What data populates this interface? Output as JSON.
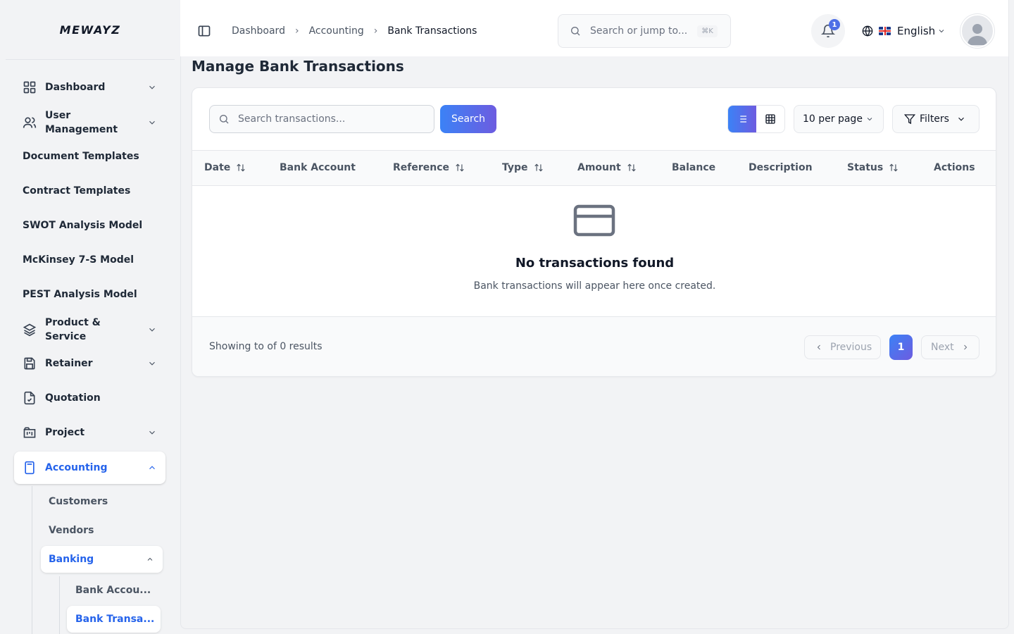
{
  "app": {
    "logo": "MEWAYZ"
  },
  "sidebar": {
    "items": [
      {
        "label": "Dashboard",
        "icon": "grid-icon",
        "has_chevron": true
      },
      {
        "label": "User Management",
        "icon": "users-icon",
        "has_chevron": true
      },
      {
        "label": "Document Templates"
      },
      {
        "label": "Contract Templates"
      },
      {
        "label": "SWOT Analysis Model"
      },
      {
        "label": "McKinsey 7-S Model"
      },
      {
        "label": "PEST Analysis Model"
      },
      {
        "label": "Product & Service",
        "icon": "layers-icon",
        "has_chevron": true
      },
      {
        "label": "Retainer",
        "icon": "save-icon",
        "has_chevron": true
      },
      {
        "label": "Quotation",
        "icon": "file-check-icon"
      },
      {
        "label": "Project",
        "icon": "kanban-icon",
        "has_chevron": true
      },
      {
        "label": "Accounting",
        "icon": "calculator-icon",
        "has_chevron": true,
        "active": true
      }
    ],
    "accounting_sub": [
      {
        "label": "Customers"
      },
      {
        "label": "Vendors"
      },
      {
        "label": "Banking",
        "active": true
      }
    ],
    "banking_sub": [
      {
        "label": "Bank Accou..."
      },
      {
        "label": "Bank Transa...",
        "active": true
      }
    ]
  },
  "header": {
    "breadcrumb": [
      "Dashboard",
      "Accounting",
      "Bank Transactions"
    ],
    "search_placeholder": "Search or jump to...",
    "search_shortcut": "⌘K",
    "notification_count": "1",
    "language": "English"
  },
  "page": {
    "title": "Manage Bank Transactions",
    "search_placeholder": "Search transactions...",
    "search_button": "Search",
    "per_page": "10 per page",
    "filters_label": "Filters",
    "columns": [
      {
        "label": "Date",
        "sortable": true
      },
      {
        "label": "Bank Account",
        "sortable": false
      },
      {
        "label": "Reference",
        "sortable": true
      },
      {
        "label": "Type",
        "sortable": true
      },
      {
        "label": "Amount",
        "sortable": true
      },
      {
        "label": "Balance",
        "sortable": false
      },
      {
        "label": "Description",
        "sortable": false
      },
      {
        "label": "Status",
        "sortable": true
      },
      {
        "label": "Actions",
        "sortable": false
      }
    ],
    "empty_title": "No transactions found",
    "empty_subtitle": "Bank transactions will appear here once created.",
    "results_text": "Showing to of 0 results",
    "pagination": {
      "previous": "Previous",
      "current_page": "1",
      "next": "Next"
    }
  },
  "colors": {
    "accent": "#2563eb",
    "gradient_start": "#3b82f6",
    "gradient_end": "#6d5ce0"
  }
}
